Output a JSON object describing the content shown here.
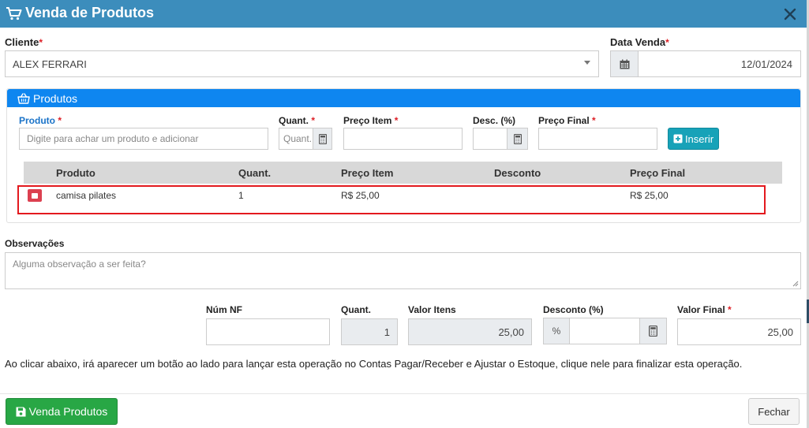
{
  "modal": {
    "title": "Venda de Produtos",
    "header_color": "#3c8dbc"
  },
  "cliente": {
    "label": "Cliente",
    "required_mark": "*",
    "value": "ALEX FERRARI"
  },
  "data_venda": {
    "label": "Data Venda",
    "required_mark": "*",
    "value": "12/01/2024"
  },
  "produtos_panel": {
    "title": "Produtos",
    "accent": "#0e86f0",
    "produto_label": "Produto",
    "produto_placeholder": "Digite para achar um produto e adicionar",
    "quant_label": "Quant.",
    "quant_placeholder": "Quant.",
    "preco_item_label": "Preço Item",
    "desc_label": "Desc. (%)",
    "preco_final_label": "Preço Final",
    "required_mark": "*",
    "insert_button": "Inserir",
    "insert_color": "#17a2b8"
  },
  "table": {
    "headers": [
      "Produto",
      "Quant.",
      "Preço Item",
      "Desconto",
      "Preço Final"
    ],
    "rows": [
      {
        "produto": "camisa pilates",
        "quant": "1",
        "preco_item": "R$ 25,00",
        "desconto": "",
        "preco_final": "R$ 25,00"
      }
    ],
    "highlight_color": "#e3191e"
  },
  "observacoes": {
    "label": "Observações",
    "placeholder": "Alguma observação a ser feita?"
  },
  "totals": {
    "num_nf_label": "Núm NF",
    "num_nf_value": "",
    "quant_label": "Quant.",
    "quant_value": "1",
    "valor_itens_label": "Valor Itens",
    "valor_itens_value": "25,00",
    "desconto_label": "Desconto (%)",
    "desconto_prefix": "%",
    "desconto_value": "",
    "valor_final_label": "Valor Final",
    "valor_final_value": "25,00",
    "required_mark": "*"
  },
  "info_text": "Ao clicar abaixo, irá aparecer um botão ao lado para lançar esta operação no Contas Pagar/Receber e Ajustar o Estoque, clique nele para finalizar esta operação.",
  "footer": {
    "venda_button": "Venda Produtos",
    "venda_color": "#28a745",
    "fechar_button": "Fechar"
  },
  "icons": [
    "cart-icon",
    "close-icon",
    "calendar-icon",
    "basket-icon",
    "calculator-icon",
    "plus-square-icon",
    "minus-square-icon",
    "save-icon"
  ]
}
